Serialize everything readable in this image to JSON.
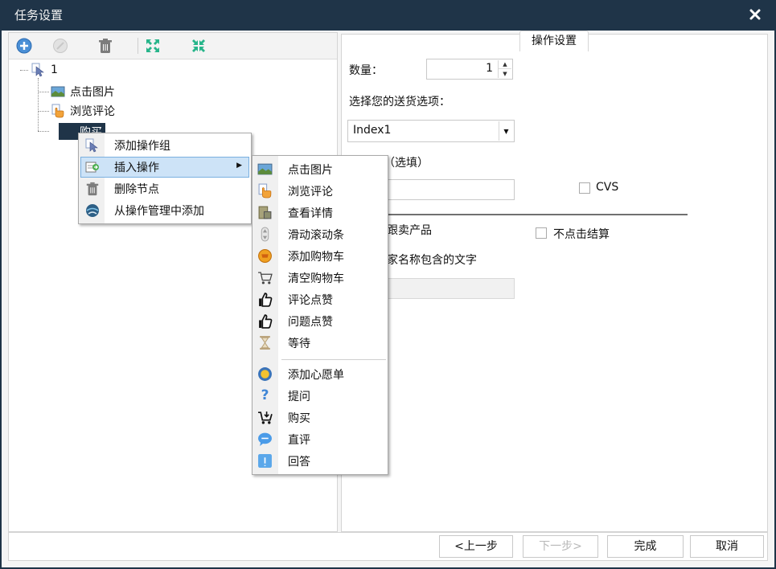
{
  "window": {
    "title": "任务设置",
    "close_icon": "close-icon"
  },
  "toolbar": {
    "buttons": [
      {
        "name": "add",
        "icon": "add-circle-icon"
      },
      {
        "name": "disable",
        "icon": "disabled-circle-icon"
      },
      {
        "name": "delete",
        "icon": "trash-icon"
      },
      {
        "name": "expand",
        "icon": "expand-arrows-icon"
      },
      {
        "name": "collapse",
        "icon": "collapse-arrows-icon"
      }
    ]
  },
  "tree": {
    "root": {
      "label": "1",
      "icon": "cursor-icon"
    },
    "children": [
      {
        "label": "点击图片",
        "icon": "image-icon"
      },
      {
        "label": "浏览评论",
        "icon": "hand-icon"
      },
      {
        "label": "购买",
        "icon": "cart-icon",
        "selected": true
      }
    ]
  },
  "context_menu": {
    "items": [
      {
        "label": "添加操作组",
        "icon": "cursor-icon"
      },
      {
        "label": "插入操作",
        "icon": "insert-icon",
        "has_submenu": true,
        "highlighted": true
      },
      {
        "label": "删除节点",
        "icon": "trash-icon"
      },
      {
        "label": "从操作管理中添加",
        "icon": "globe-icon"
      }
    ]
  },
  "submenu": {
    "items": [
      {
        "label": "点击图片",
        "icon": "image-icon"
      },
      {
        "label": "浏览评论",
        "icon": "hand-icon"
      },
      {
        "label": "查看详情",
        "icon": "details-icon"
      },
      {
        "label": "滑动滚动条",
        "icon": "scroll-icon"
      },
      {
        "label": "添加购物车",
        "icon": "add-cart-icon"
      },
      {
        "label": "清空购物车",
        "icon": "empty-cart-icon"
      },
      {
        "label": "评论点赞",
        "icon": "thumbs-up-icon"
      },
      {
        "label": "问题点赞",
        "icon": "thumbs-up-icon"
      },
      {
        "label": "等待",
        "icon": "hourglass-icon"
      },
      {
        "label": "添加心愿单",
        "icon": "wishlist-icon"
      },
      {
        "label": "提问",
        "icon": "question-icon"
      },
      {
        "label": "购买",
        "icon": "buy-cart-icon"
      },
      {
        "label": "直评",
        "icon": "comment-bubble-icon"
      },
      {
        "label": "回答",
        "icon": "answer-icon"
      }
    ]
  },
  "settings": {
    "group_title": "操作设置",
    "quantity_label": "数量：",
    "quantity_value": "1",
    "shipping_label": "选择您的送货选项：",
    "shipping_selected": "Index1",
    "asin_label_visible": "SIN（选填）",
    "asin_value": "",
    "cvs_label": "CVS",
    "cvs_checked": false,
    "follow_sell_label_visible": "跟卖产品",
    "no_checkout_label": "不点击结算",
    "no_checkout_checked": false,
    "seller_name_label_visible": "家名称包含的文字",
    "seller_name_value": ""
  },
  "footer": {
    "prev_label": "<上一步",
    "next_label": "下一步>",
    "finish_label": "完成",
    "cancel_label": "取消"
  }
}
